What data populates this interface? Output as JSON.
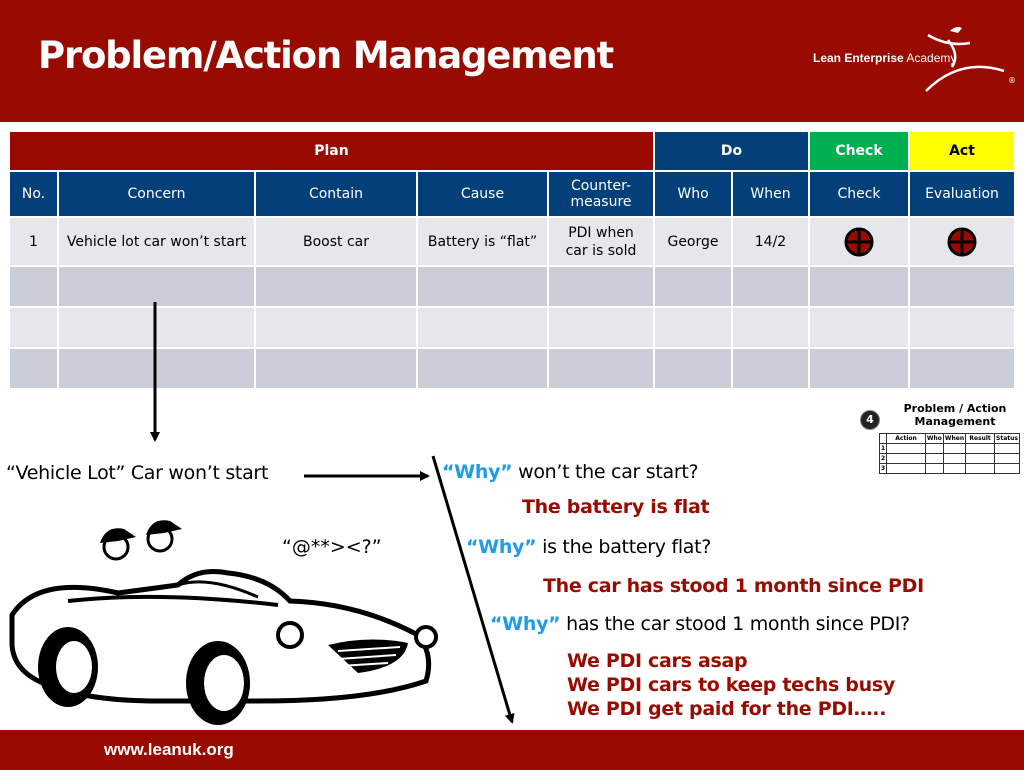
{
  "header": {
    "title": "Problem/Action Management",
    "logo_bold": "Lean Enterprise",
    "logo_light": "Academy",
    "logo_mark": "®"
  },
  "colors": {
    "brand_red": "#990a00",
    "plan": "#990a00",
    "do": "#03407a",
    "check": "#00b050",
    "act": "#ffff00",
    "why_blue": "#1f9be8"
  },
  "table": {
    "phases": [
      {
        "label": "Plan"
      },
      {
        "label": "Do"
      },
      {
        "label": "Check"
      },
      {
        "label": "Act"
      }
    ],
    "columns": [
      "No.",
      "Concern",
      "Contain",
      "Cause",
      "Counter-",
      "measure",
      "Who",
      "When",
      "Check",
      "Evaluation"
    ],
    "rows": [
      {
        "no": "1",
        "concern": "Vehicle lot car won’t start",
        "contain": "Boost car",
        "cause": "Battery is “flat”",
        "countermeasure_line1": "PDI when",
        "countermeasure_line2": "car is sold",
        "who": "George",
        "when": "14/2",
        "check_status": "quarter-circle-empty",
        "evaluation_status": "quarter-circle-empty"
      }
    ]
  },
  "diagram": {
    "problem": "“Vehicle Lot” Car won’t start",
    "speech": "“@**><?”",
    "whys": [
      {
        "why": "“Why”",
        "question": " won’t the car start?"
      },
      {
        "why": "“Why”",
        "question": " is the battery flat?"
      },
      {
        "why": "“Why”",
        "question": " has the car stood 1 month since PDI?"
      }
    ],
    "answers": [
      "The battery is flat",
      "The car has stood 1 month since PDI",
      "We PDI cars asap",
      "We PDI cars to keep techs busy",
      "We PDI get paid for the PDI….."
    ]
  },
  "mini_form": {
    "badge": "4",
    "title_line1": "Problem / Action",
    "title_line2": "Management",
    "columns": [
      "",
      "Action",
      "Who",
      "When",
      "Result",
      "Status"
    ],
    "rows": [
      "1",
      "2",
      "3"
    ]
  },
  "footer": {
    "url": "www.leanuk.org"
  }
}
